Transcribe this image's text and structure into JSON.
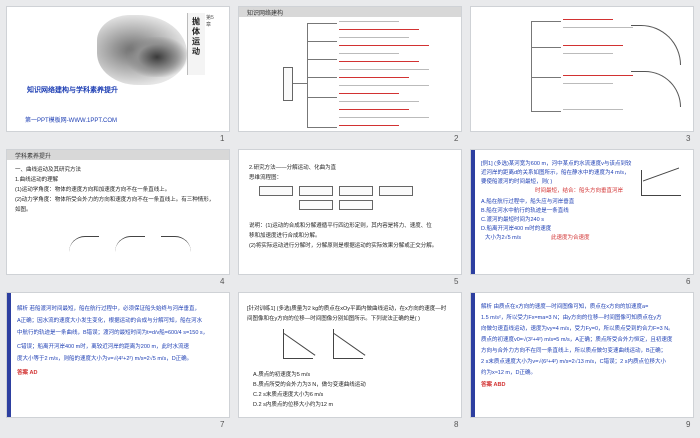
{
  "slides": [
    {
      "num": "1",
      "title_main": "抛体运动",
      "title_chapter": "第5章",
      "subtitle": "知识网络建构与学科素养提升",
      "watermark": "第一PPT模板网-WWW.1PPT.COM"
    },
    {
      "num": "2",
      "header": "知识网络建构"
    },
    {
      "num": "3"
    },
    {
      "num": "4",
      "header": "学科素养提升",
      "lines": [
        "一、曲线运动及其研究方法",
        "1.曲线运动的理解",
        "(1)运动学角度：物体的速度方向和加速度方向不在一条直线上。",
        "(2)动力学角度：物体所受合外力的方向和速度方向不在一条直线上。有三种情形，",
        "如图。"
      ]
    },
    {
      "num": "5",
      "lines": [
        "2.研究方法——分解运动、化曲为直",
        "思维流程图：",
        "说明：(1)运动的合成和分解遵循平行四边形定则，其内容是将力、速度、位",
        "移和加速度进行合成和分解。",
        "(2)将实际运动进行分解时，分解原则是根据运动的实际效果分解或正交分解。"
      ]
    },
    {
      "num": "6",
      "lines": [
        "[例1] (多选)某河宽为600 m，河中某点的水流速度v与该点到较",
        "近河岸的距离d的关系如图所示，船在静水中的速度为4 m/s，",
        "要使船渡河的时间最短，则(    )",
        "A.船在航行过程中，船头应与河岸垂直",
        "B.船在河水中航行的轨迹是一条直线",
        "C.渡河的最短时间为240 s",
        "D.船离开河岸400 m时的速度",
        "大小为2√5 m/s"
      ],
      "red_note1": "时间最短，结合：船头方向垂直河岸",
      "red_note2": "此速度为合速度"
    },
    {
      "num": "7",
      "lines": [
        "解析  若船渡河时间最短，船在航行过程中，必须保证船头始终与河岸垂直，",
        "A正确；因水流的速度大小发生变化，根据运动的合成与分解可知，船在河水",
        "中航行的轨迹是一条曲线，B错误；渡河的最短时间为t=d/v船=600/4 s=150 s，",
        "C错误；船离开河岸400 m时，离较近河岸的距离为200 m，此时水流速",
        "度大小等于2 m/s，则船的速度大小为v=√(4²+2²) m/s=2√5 m/s，D正确。"
      ],
      "answer": "答案  AD"
    },
    {
      "num": "8",
      "lines": [
        "[针对训练1] (多选)质量为2 kg的质点在xOy平面内做曲线运动，在x方向的速度—时",
        "间图像和在y方向的位移—时间图像分别如图所示。下列说法正确的是(    )",
        "A.质点的初速度为5 m/s",
        "B.质点所受的合外力为3 N，做匀变速曲线运动",
        "C.2 s末质点速度大小为6 m/s",
        "D.2 s内质点的位移大小约为12 m"
      ]
    },
    {
      "num": "9",
      "lines": [
        "解析  由质点在x方向的速度—时间图像可知，质点在x方向的加速度a=",
        "1.5 m/s²，所以受力Fx=ma=3 N；由y方向的位移—时间图像可知质点在y方",
        "向做匀速直线运动，速度为vy=4 m/s，受力Fy=0，所以质点受到的合力F=3 N。",
        "质点的初速度v0=√(3²+4²) m/s=5 m/s，A正确；质点所受合外力恒定，且初速度",
        "方向与合外力方向不在同一条直线上，所以质点做匀变速曲线运动，B正确；",
        "2 s末质点速度大小为v=√(6²+4²) m/s=2√13 m/s，C错误；2 s内质点位移大小",
        "约为x≈12 m，D正确。"
      ],
      "answer": "答案  ABD"
    }
  ],
  "colors": {
    "accent": "#2d3fa0",
    "note": "#d23232",
    "text_blue": "#1e3fb4"
  }
}
